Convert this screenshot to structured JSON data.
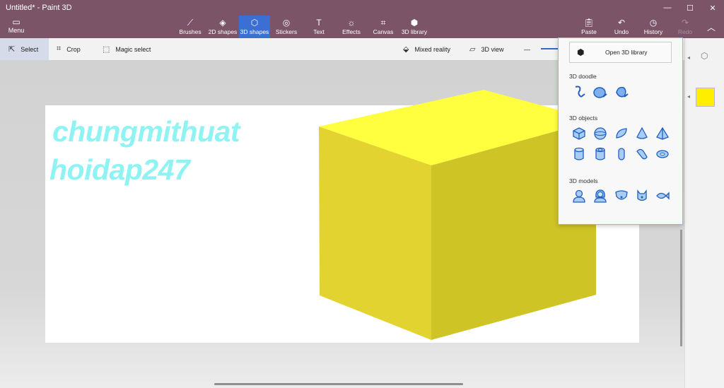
{
  "app": {
    "title": "Untitled* - Paint 3D"
  },
  "ribbon": {
    "menu_label": "Menu",
    "tools": [
      {
        "label": "Brushes",
        "icon": "brush-icon"
      },
      {
        "label": "2D shapes",
        "icon": "2d-shapes-icon"
      },
      {
        "label": "3D shapes",
        "icon": "3d-shapes-icon"
      },
      {
        "label": "Stickers",
        "icon": "stickers-icon"
      },
      {
        "label": "Text",
        "icon": "text-icon"
      },
      {
        "label": "Effects",
        "icon": "effects-icon"
      },
      {
        "label": "Canvas",
        "icon": "canvas-icon"
      },
      {
        "label": "3D library",
        "icon": "3d-library-icon"
      },
      {
        "label": "Paste",
        "icon": "paste-icon"
      },
      {
        "label": "Undo",
        "icon": "undo-icon"
      },
      {
        "label": "History",
        "icon": "history-icon"
      },
      {
        "label": "Redo",
        "icon": "redo-icon"
      }
    ],
    "active_tool": "3D shapes"
  },
  "toolbar": {
    "select": "Select",
    "crop": "Crop",
    "magic_select": "Magic select",
    "mixed_reality": "Mixed reality",
    "view_3d": "3D view"
  },
  "canvas": {
    "text_lines": [
      "chungmithuat",
      "hoidap247"
    ],
    "text_color": "#8ff3f3",
    "object": "yellow cube"
  },
  "panel": {
    "open_library": "Open 3D library",
    "doodle_title": "3D doodle",
    "objects_title": "3D objects",
    "models_title": "3D models",
    "doodle_icons": [
      "sharp-edge-doodle-icon",
      "soft-edge-doodle-icon",
      "tube-doodle-icon"
    ],
    "object_icons": [
      "cube-icon",
      "sphere-icon",
      "hemisphere-icon",
      "cone-icon",
      "pyramid-icon",
      "cylinder-icon",
      "tube-icon",
      "capsule-icon",
      "curved-shape-icon",
      "donut-icon"
    ],
    "model_icons": [
      "man-icon",
      "woman-icon",
      "dog-icon",
      "cat-icon",
      "fish-icon"
    ]
  },
  "colors": {
    "accent": "#3b6fd4",
    "selected_color": "#ffee00",
    "title_bar": "#7b5567"
  }
}
